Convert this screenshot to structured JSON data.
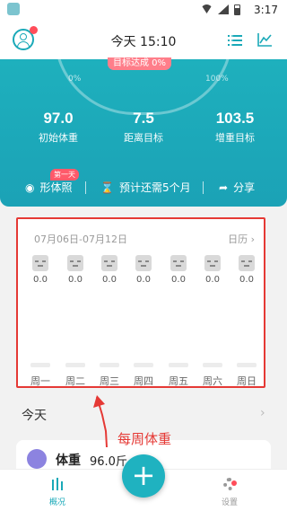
{
  "status_bar": {
    "time": "3:17"
  },
  "header": {
    "title": "今天 15:10"
  },
  "summary": {
    "goal_badge": "目标达成 0%",
    "progress_left": "0%",
    "progress_right": "100%",
    "stats": [
      {
        "value": "97.0",
        "label": "初始体重"
      },
      {
        "value": "7.5",
        "label": "距离目标"
      },
      {
        "value": "103.5",
        "label": "增重目标"
      }
    ],
    "actions": {
      "photo_label": "形体照",
      "first_day_badge": "第一天",
      "estimate_label": "预计还需5个月",
      "share_label": "分享"
    }
  },
  "weekly": {
    "date_range": "07月06日-07月12日",
    "calendar_label": "日历",
    "calendar_chevron": "›",
    "days": [
      {
        "day": "周一",
        "value": "0.0"
      },
      {
        "day": "周二",
        "value": "0.0"
      },
      {
        "day": "周三",
        "value": "0.0"
      },
      {
        "day": "周四",
        "value": "0.0"
      },
      {
        "day": "周五",
        "value": "0.0"
      },
      {
        "day": "周六",
        "value": "0.0"
      },
      {
        "day": "周日",
        "value": "0.0"
      }
    ]
  },
  "annotation": {
    "text": "每周体重"
  },
  "today_section": {
    "label": "今天",
    "chevron": "›"
  },
  "weight_card": {
    "label": "体重",
    "value": "96.0斤"
  },
  "bottom_nav": {
    "overview_label": "概况",
    "add_label": "+",
    "settings_label": "设置"
  },
  "colors": {
    "accent": "#1aa9b8",
    "highlight_border": "#e53935",
    "badge": "#ff5a6a"
  }
}
